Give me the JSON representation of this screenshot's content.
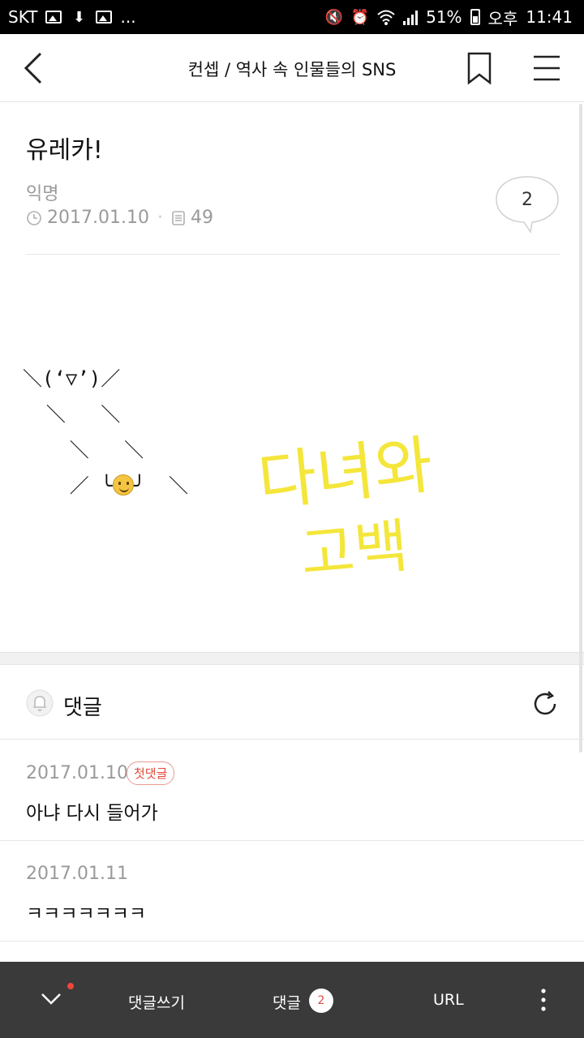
{
  "status_bar": {
    "carrier": "SKT",
    "more": "...",
    "battery": "51%",
    "time_label": "오후",
    "time": "11:41"
  },
  "header": {
    "title": "컨셉 / 역사 속 인물들의 SNS"
  },
  "post": {
    "title": "유레카!",
    "author": "익명",
    "date": "2017.01.10",
    "views": "49",
    "comment_count": "2"
  },
  "body": {
    "ascii_line1": "＼(‘▽’)／",
    "ascii_line2": "  ＼   ＼",
    "ascii_line3": "    ＼   ＼",
    "ascii_line4_left": "    ／ ╰",
    "ascii_line4_right": "╯  ＼",
    "handwriting_line1": "다녀와",
    "handwriting_line2": "고백"
  },
  "comments_section": {
    "label": "댓글",
    "items": [
      {
        "date": "2017.01.10",
        "badge": "첫댓글",
        "text": "아냐 다시 들어가"
      },
      {
        "date": "2017.01.11",
        "badge": "",
        "text": "ㅋㅋㅋㅋㅋㅋㅋ"
      }
    ]
  },
  "bottom_bar": {
    "write_label": "댓글쓰기",
    "comments_label": "댓글",
    "comments_count": "2",
    "url_label": "URL"
  },
  "colors": {
    "accent_red": "#e0493b",
    "handwriting_yellow": "#f4e63a",
    "bottom_bar": "#3a3a3a"
  }
}
